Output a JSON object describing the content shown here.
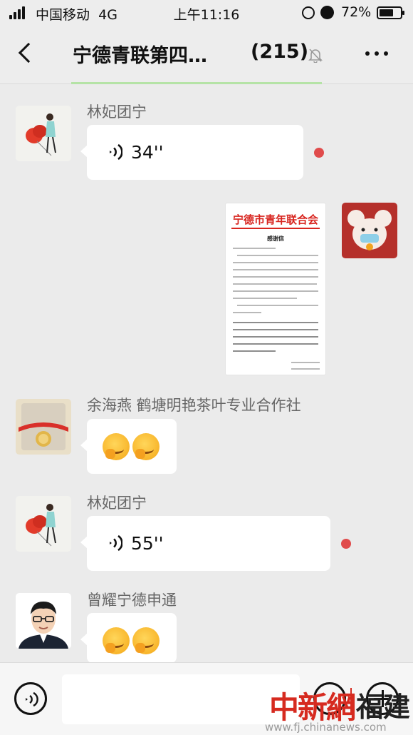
{
  "status_bar": {
    "carrier": "中国移动",
    "network": "4G",
    "time": "上午11:16",
    "battery_percent": "72%",
    "battery_level": 0.72
  },
  "nav": {
    "title": "宁德青联第四…",
    "member_count": "(215)",
    "icons": [
      "back-icon",
      "mute-bell-icon",
      "more-icon"
    ]
  },
  "messages": [
    {
      "sender": "林妃团宁",
      "type": "voice",
      "duration": "34''",
      "unread": true
    },
    {
      "sender": "",
      "type": "image",
      "from_self": true,
      "letter": {
        "org": "宁德市青年联合会",
        "heading": "感谢信"
      }
    },
    {
      "sender": "余海燕 鹤塘明艳茶叶专业合作社",
      "type": "emoji",
      "emoji": [
        "blush-hand-emoji",
        "blush-hand-emoji"
      ]
    },
    {
      "sender": "林妃团宁",
      "type": "voice",
      "duration": "55''",
      "unread": true
    },
    {
      "sender": "曾耀宁德申通",
      "type": "emoji",
      "emoji": [
        "blush-hand-emoji",
        "blush-hand-emoji"
      ]
    }
  ],
  "input_bar": {
    "icons": [
      "voice-toggle-icon",
      "emoji-icon",
      "plus-icon"
    ],
    "placeholder": ""
  },
  "watermark": {
    "main": "中新網",
    "region": "福建",
    "url": "www.fj.chinanews.com"
  },
  "colors": {
    "background": "#ebebeb",
    "bubble": "#ffffff",
    "unread_dot": "#e04b4b",
    "letter_red": "#d8251f",
    "watermark_red": "#d62a1f"
  }
}
